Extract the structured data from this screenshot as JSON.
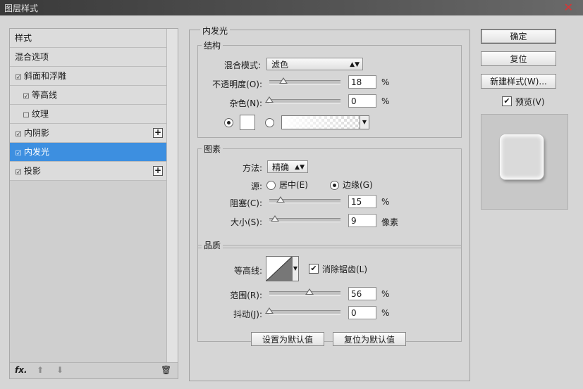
{
  "window": {
    "title": "图层样式"
  },
  "sidebar": {
    "items": [
      {
        "label": "样式",
        "checkbox": false,
        "checked": false,
        "plus": false,
        "selected": false
      },
      {
        "label": "混合选项",
        "checkbox": false,
        "checked": false,
        "plus": false,
        "selected": false
      },
      {
        "label": "斜面和浮雕",
        "checkbox": true,
        "checked": true,
        "plus": false,
        "selected": false
      },
      {
        "label": "等高线",
        "checkbox": true,
        "checked": true,
        "plus": false,
        "selected": false
      },
      {
        "label": "纹理",
        "checkbox": true,
        "checked": false,
        "plus": false,
        "selected": false
      },
      {
        "label": "内阴影",
        "checkbox": true,
        "checked": true,
        "plus": true,
        "selected": false
      },
      {
        "label": "内发光",
        "checkbox": true,
        "checked": true,
        "plus": false,
        "selected": true
      },
      {
        "label": "投影",
        "checkbox": true,
        "checked": true,
        "plus": true,
        "selected": false
      }
    ],
    "footer": {
      "fx": "fx."
    }
  },
  "panel": {
    "title": "内发光",
    "structure": {
      "title": "结构",
      "blend_mode_label": "混合模式:",
      "blend_mode_value": "滤色",
      "opacity_label": "不透明度(O):",
      "opacity_value": "18",
      "opacity_unit": "%",
      "noise_label": "杂色(N):",
      "noise_value": "0",
      "noise_unit": "%",
      "color_selected": "solid"
    },
    "elements": {
      "title": "图素",
      "method_label": "方法:",
      "method_value": "精确",
      "source_label": "源:",
      "source_center": "居中(E)",
      "source_edge": "边缘(G)",
      "source_selected": "edge",
      "choke_label": "阻塞(C):",
      "choke_value": "15",
      "choke_unit": "%",
      "size_label": "大小(S):",
      "size_value": "9",
      "size_unit": "像素"
    },
    "quality": {
      "title": "品质",
      "contour_label": "等高线:",
      "antialias_label": "消除锯齿(L)",
      "antialias_checked": true,
      "range_label": "范围(R):",
      "range_value": "56",
      "range_unit": "%",
      "jitter_label": "抖动(J):",
      "jitter_value": "0",
      "jitter_unit": "%"
    },
    "set_default": "设置为默认值",
    "reset_default": "复位为默认值"
  },
  "actions": {
    "ok": "确定",
    "reset": "复位",
    "new_style": "新建样式(W)...",
    "preview_label": "预览(V)",
    "preview_checked": true
  },
  "colors": {
    "selected_row": "#3d8fe0",
    "dialog_bg": "#d6d6d6"
  }
}
